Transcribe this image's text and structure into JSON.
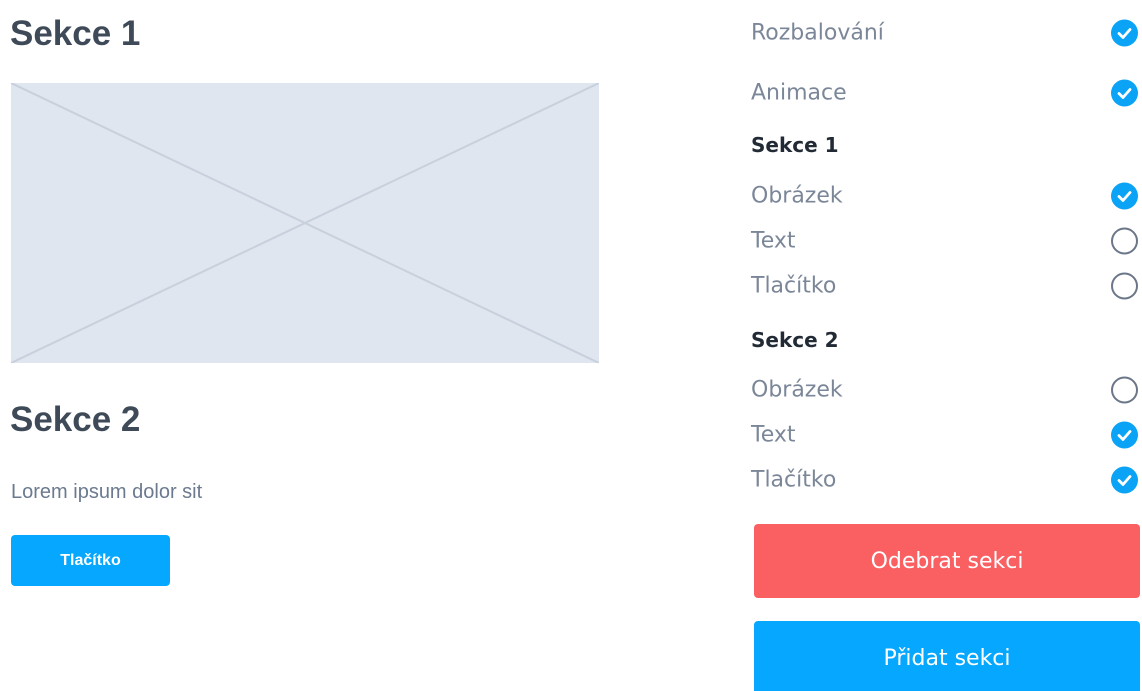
{
  "preview": {
    "section1_title": "Sekce 1",
    "section2_title": "Sekce 2",
    "section2_text": "Lorem ipsum dolor sit",
    "section2_button": "Tlačítko",
    "image_icon": "image-placeholder-icon"
  },
  "settings": {
    "global": [
      {
        "label": "Rozbalování",
        "checked": true
      },
      {
        "label": "Animace",
        "checked": true
      }
    ],
    "section1": {
      "title": "Sekce 1",
      "items": [
        {
          "label": "Obrázek",
          "checked": true
        },
        {
          "label": "Text",
          "checked": false
        },
        {
          "label": "Tlačítko",
          "checked": false
        }
      ]
    },
    "section2": {
      "title": "Sekce 2",
      "items": [
        {
          "label": "Obrázek",
          "checked": false
        },
        {
          "label": "Text",
          "checked": true
        },
        {
          "label": "Tlačítko",
          "checked": true
        }
      ]
    },
    "remove_button": "Odebrat sekci",
    "add_button": "Přidat sekci"
  },
  "colors": {
    "primary": "#05a7ff",
    "danger": "#fa5f62",
    "check_on": "#0aa3f5",
    "title_text": "#3f4a58",
    "muted_text": "#7b8798",
    "placeholder_bg": "#dfe6ef"
  }
}
